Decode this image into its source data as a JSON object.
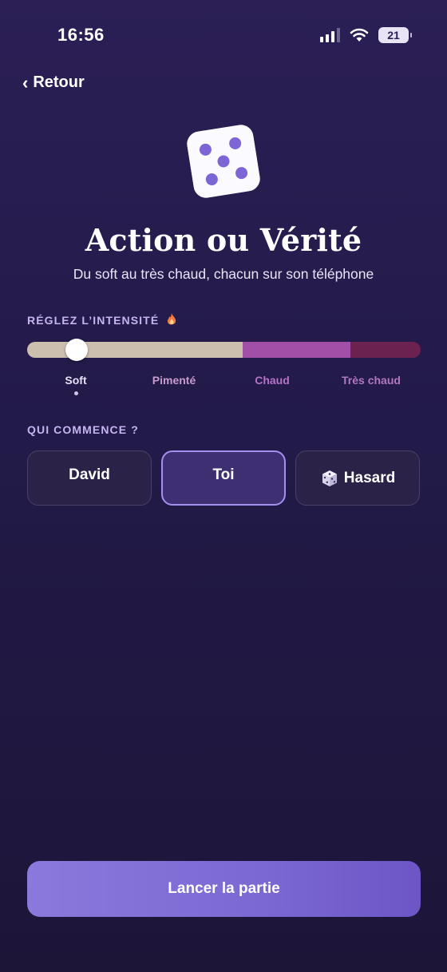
{
  "status_bar": {
    "time": "16:56",
    "battery": "21"
  },
  "nav": {
    "back_label": "Retour"
  },
  "hero": {
    "title": "Action ou Vérité",
    "subtitle": "Du soft au très chaud, chacun sur son téléphone"
  },
  "intensity": {
    "label": "RÉGLEZ L’INTENSITÉ",
    "levels": [
      "Soft",
      "Pimenté",
      "Chaud",
      "Très chaud"
    ],
    "selected": "Soft"
  },
  "starter": {
    "label": "QUI COMMENCE ?",
    "options": [
      "David",
      "Toi",
      "Hasard"
    ],
    "selected": "Toi"
  },
  "cta": {
    "label": "Lancer la partie"
  },
  "colors": {
    "accent": "#a48ff0",
    "cta": "#7b68d2",
    "background": "#251b4d"
  }
}
